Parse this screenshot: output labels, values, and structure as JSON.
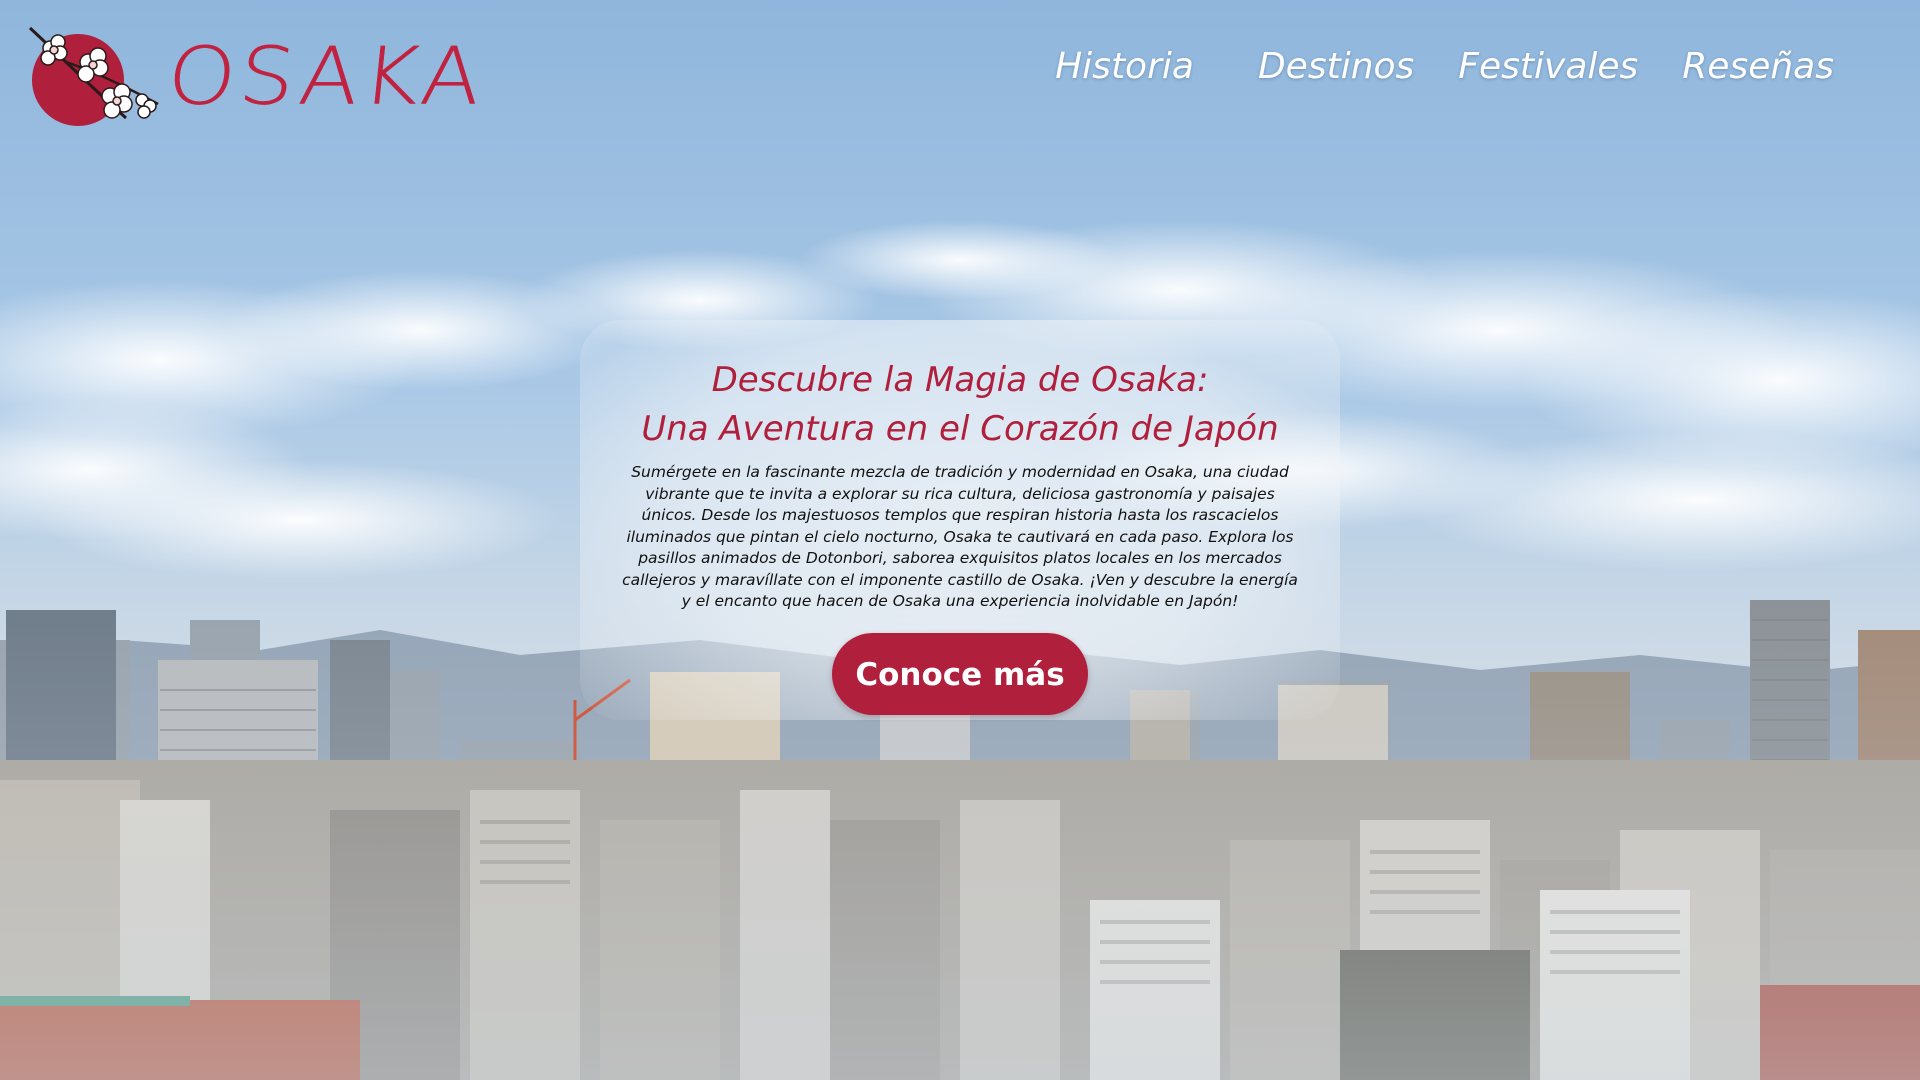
{
  "logo": {
    "text": "OSAKA",
    "emblem": "plum-blossom-sun-icon",
    "brand_color": "#b01f3c"
  },
  "nav": {
    "items": [
      {
        "label": "Historia"
      },
      {
        "label": "Destinos"
      },
      {
        "label": "Festivales"
      },
      {
        "label": "Reseñas"
      }
    ]
  },
  "hero": {
    "title_line1": "Descubre la Magia de Osaka:",
    "title_line2": "Una Aventura en el Corazón de Japón",
    "body": "Sumérgete en la fascinante mezcla de tradición y modernidad en Osaka, una ciudad vibrante que te invita a explorar su rica cultura, deliciosa gastronomía y paisajes únicos. Desde los majestuosos templos que respiran historia hasta los rascacielos iluminados que pintan el cielo nocturno, Osaka te cautivará en cada paso. Explora los pasillos animados de Dotonbori, saborea exquisitos platos locales en los mercados callejeros y maravíllate con el imponente castillo de Osaka. ¡Ven y descubre la energía y el encanto que hacen de Osaka una experiencia inolvidable en Japón!",
    "cta_label": "Conoce más"
  },
  "background": {
    "description_icon": "osaka-city-skyline-image",
    "sky_color": "#9fc2e2"
  }
}
